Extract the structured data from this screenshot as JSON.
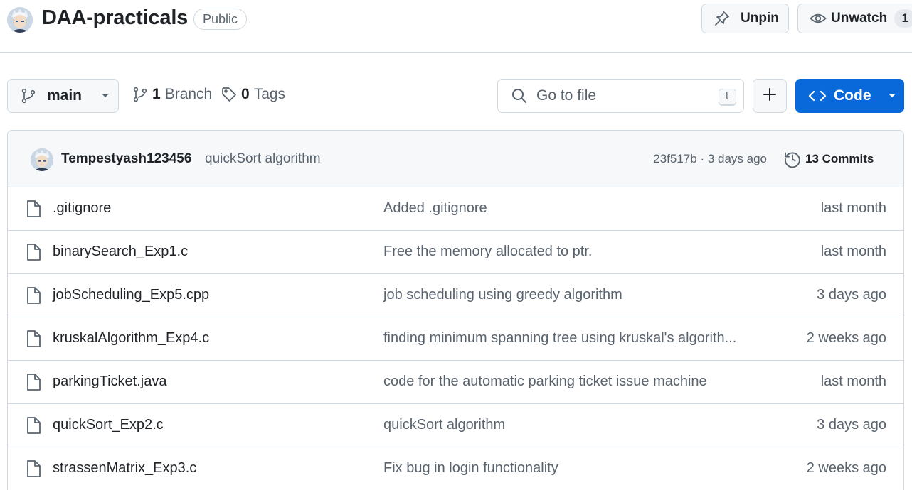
{
  "repo": {
    "name": "DAA-practicals",
    "visibility": "Public",
    "avatar_icon": "user-avatar"
  },
  "actions": {
    "unpin_label": "Unpin",
    "unpin_icon": "pin-icon",
    "unwatch_label": "Unwatch",
    "unwatch_icon": "eye-icon",
    "watch_count": "1"
  },
  "toolbar": {
    "branch": "main",
    "branch_count": "1",
    "branch_label": "Branch",
    "tag_count": "0",
    "tag_label": "Tags",
    "search_placeholder": "Go to file",
    "search_shortcut": "t",
    "code_label": "Code"
  },
  "latest_commit": {
    "author": "Tempestyash123456",
    "message": "quickSort algorithm",
    "meta": "23f517b · 3 days ago",
    "commits_label": "13 Commits"
  },
  "files": [
    {
      "name": ".gitignore",
      "message": "Added .gitignore",
      "date": "last month"
    },
    {
      "name": "binarySearch_Exp1.c",
      "message": "Free the memory allocated to ptr.",
      "date": "last month"
    },
    {
      "name": "jobScheduling_Exp5.cpp",
      "message": "job scheduling using greedy algorithm",
      "date": "3 days ago"
    },
    {
      "name": "kruskalAlgorithm_Exp4.c",
      "message": "finding minimum spanning tree using kruskal's algorith...",
      "date": "2 weeks ago"
    },
    {
      "name": "parkingTicket.java",
      "message": "code for the automatic parking ticket issue machine",
      "date": "last month"
    },
    {
      "name": "quickSort_Exp2.c",
      "message": "quickSort algorithm",
      "date": "3 days ago"
    },
    {
      "name": "strassenMatrix_Exp3.c",
      "message": "Fix bug in login functionality",
      "date": "2 weeks ago"
    }
  ],
  "colors": {
    "accent": "#0969da",
    "border": "#d1d9e0",
    "muted_text": "#59636e",
    "text": "#1f2328",
    "subtle_bg": "#f6f8fa"
  }
}
